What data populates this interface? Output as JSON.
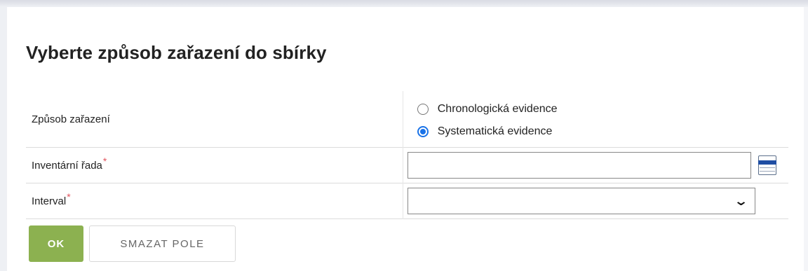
{
  "form": {
    "title": "Vyberte způsob zařazení do sbírky",
    "rows": {
      "placement": {
        "label": "Způsob zařazení",
        "options": [
          {
            "label": "Chronologická evidence",
            "checked": false
          },
          {
            "label": "Systematická evidence",
            "checked": true
          }
        ]
      },
      "inventory_series": {
        "label": "Inventární řada",
        "required_mark": "*",
        "value": ""
      },
      "interval": {
        "label": "Interval",
        "required_mark": "*",
        "selected": ""
      }
    },
    "buttons": {
      "ok_label": "OK",
      "clear_label": "SMAZAT POLE"
    },
    "colors": {
      "ok_button": "#8cb150",
      "required_mark": "#e2545e",
      "radio_accent": "#1a73e8",
      "picker_icon": "#1f4ea3"
    },
    "icons": {
      "picker": "list-picker-icon",
      "select_arrow": "chevron-down-icon"
    }
  }
}
